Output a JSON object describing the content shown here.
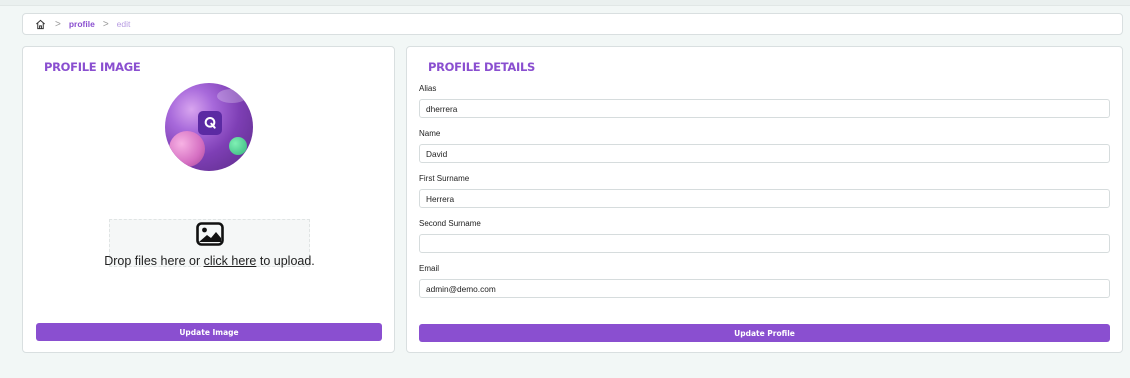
{
  "breadcrumb": {
    "home_icon": "home-icon",
    "separator": ">",
    "items": [
      {
        "label": "profile"
      },
      {
        "label": "edit"
      }
    ]
  },
  "profile_image": {
    "title": "PROFILE IMAGE",
    "dropzone": {
      "icon": "image-icon",
      "text_before": "Drop files here or ",
      "link_text": "click here",
      "text_after": " to upload."
    },
    "button_label": "Update Image"
  },
  "profile_details": {
    "title": "PROFILE DETAILS",
    "fields": [
      {
        "label": "Alias",
        "value": "dherrera"
      },
      {
        "label": "Name",
        "value": "David"
      },
      {
        "label": "First Surname",
        "value": "Herrera"
      },
      {
        "label": "Second Surname",
        "value": ""
      },
      {
        "label": "Email",
        "value": "admin@demo.com"
      }
    ],
    "button_label": "Update Profile"
  },
  "colors": {
    "accent": "#8a4fd0",
    "accent_light": "#b79ce2",
    "page_bg": "#f2f7f6"
  }
}
